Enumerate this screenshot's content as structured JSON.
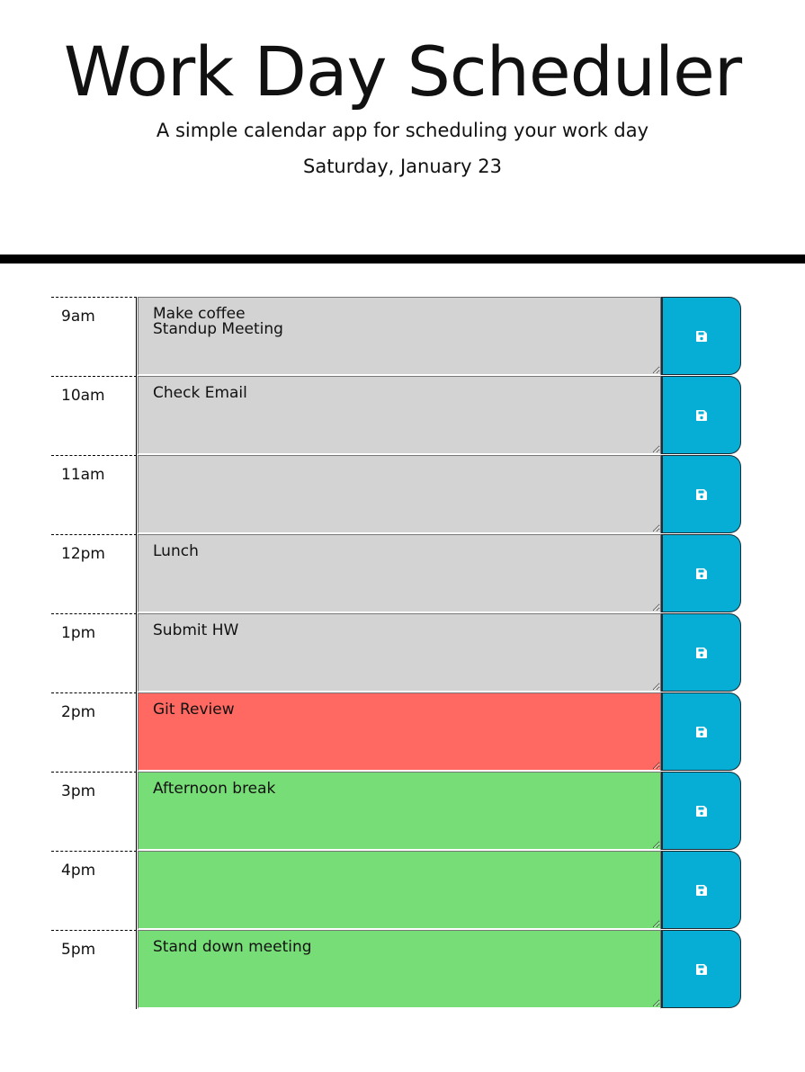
{
  "header": {
    "title": "Work Day Scheduler",
    "subtitle": "A simple calendar app for scheduling your work day",
    "current_date": "Saturday, January 23"
  },
  "colors": {
    "past": "#d3d3d3",
    "present": "#ff6961",
    "future": "#77dd77",
    "save_button": "#06aed5"
  },
  "save_icon": "floppy-disk-icon",
  "time_blocks": [
    {
      "hour": "9am",
      "status": "past",
      "text": "Make coffee\nStandup Meeting"
    },
    {
      "hour": "10am",
      "status": "past",
      "text": "Check Email"
    },
    {
      "hour": "11am",
      "status": "past",
      "text": ""
    },
    {
      "hour": "12pm",
      "status": "past",
      "text": "Lunch"
    },
    {
      "hour": "1pm",
      "status": "past",
      "text": "Submit HW"
    },
    {
      "hour": "2pm",
      "status": "present",
      "text": "Git Review"
    },
    {
      "hour": "3pm",
      "status": "future",
      "text": "Afternoon break"
    },
    {
      "hour": "4pm",
      "status": "future",
      "text": ""
    },
    {
      "hour": "5pm",
      "status": "future",
      "text": "Stand down meeting"
    }
  ]
}
